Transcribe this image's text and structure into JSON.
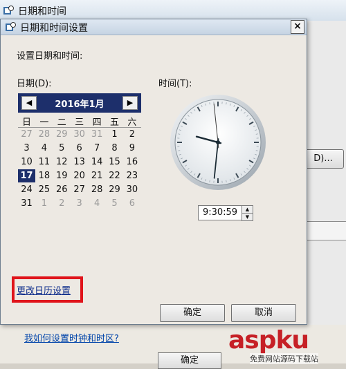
{
  "background_window": {
    "title": "日期和时间",
    "side_button_label": "D)...",
    "link_text": "我如何设置时钟和时区?",
    "ok_label": "确定"
  },
  "dialog": {
    "title": "日期和时间设置",
    "close_glyph": "×",
    "prompt": "设置日期和时间:",
    "date_label": "日期(D):",
    "time_label": "时间(T):",
    "calendar": {
      "month_label": "2016年1月",
      "prev_glyph": "◀",
      "next_glyph": "▶",
      "weekdays": [
        "日",
        "一",
        "二",
        "三",
        "四",
        "五",
        "六"
      ],
      "selected_day": 17,
      "weeks": [
        [
          {
            "d": "27",
            "o": true
          },
          {
            "d": "28",
            "o": true
          },
          {
            "d": "29",
            "o": true
          },
          {
            "d": "30",
            "o": true
          },
          {
            "d": "31",
            "o": true
          },
          {
            "d": "1",
            "o": false
          },
          {
            "d": "2",
            "o": false
          }
        ],
        [
          {
            "d": "3",
            "o": false
          },
          {
            "d": "4",
            "o": false
          },
          {
            "d": "5",
            "o": false
          },
          {
            "d": "6",
            "o": false
          },
          {
            "d": "7",
            "o": false
          },
          {
            "d": "8",
            "o": false
          },
          {
            "d": "9",
            "o": false
          }
        ],
        [
          {
            "d": "10",
            "o": false
          },
          {
            "d": "11",
            "o": false
          },
          {
            "d": "12",
            "o": false
          },
          {
            "d": "13",
            "o": false
          },
          {
            "d": "14",
            "o": false
          },
          {
            "d": "15",
            "o": false
          },
          {
            "d": "16",
            "o": false
          }
        ],
        [
          {
            "d": "17",
            "o": false
          },
          {
            "d": "18",
            "o": false
          },
          {
            "d": "19",
            "o": false
          },
          {
            "d": "20",
            "o": false
          },
          {
            "d": "21",
            "o": false
          },
          {
            "d": "22",
            "o": false
          },
          {
            "d": "23",
            "o": false
          }
        ],
        [
          {
            "d": "24",
            "o": false
          },
          {
            "d": "25",
            "o": false
          },
          {
            "d": "26",
            "o": false
          },
          {
            "d": "27",
            "o": false
          },
          {
            "d": "28",
            "o": false
          },
          {
            "d": "29",
            "o": false
          },
          {
            "d": "30",
            "o": false
          }
        ],
        [
          {
            "d": "31",
            "o": false
          },
          {
            "d": "1",
            "o": true
          },
          {
            "d": "2",
            "o": true
          },
          {
            "d": "3",
            "o": true
          },
          {
            "d": "4",
            "o": true
          },
          {
            "d": "5",
            "o": true
          },
          {
            "d": "6",
            "o": true
          }
        ]
      ]
    },
    "clock": {
      "hour": 9,
      "minute": 30,
      "second": 59
    },
    "time_value": "9:30:59",
    "change_calendar_link": "更改日历设置",
    "ok_button": "确定",
    "cancel_button": "取消"
  },
  "watermark": {
    "text": "aspku",
    "subtext": "免费网站源码下载站"
  },
  "colors": {
    "calendar_header": "#1d2f6b",
    "highlight_box": "#e0141b",
    "link": "#0a2a8a",
    "watermark": "#c62026"
  }
}
